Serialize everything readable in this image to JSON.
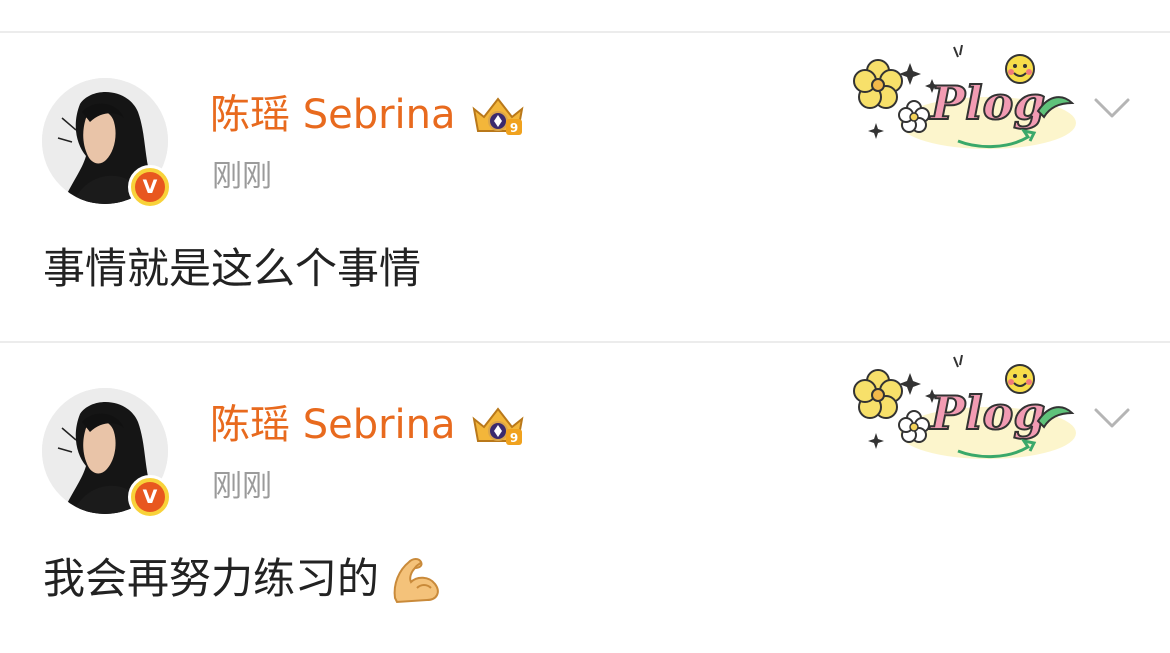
{
  "posts": [
    {
      "username": "陈瑶 Sebrina",
      "timestamp": "刚刚",
      "text": "事情就是这么个事情",
      "sticker_text": "Plog",
      "verified_letter": "V",
      "vip_level": "9",
      "has_emoji": false
    },
    {
      "username": "陈瑶 Sebrina",
      "timestamp": "刚刚",
      "text": "我会再努力练习的",
      "sticker_text": "Plog",
      "verified_letter": "V",
      "vip_level": "9",
      "has_emoji": true,
      "emoji": "flexed-biceps-icon"
    }
  ],
  "colors": {
    "username": "#e86a1e",
    "timestamp": "#9b9b9b",
    "post_text": "#222222",
    "verified_badge": "#e8571f",
    "verified_ring": "#f8d23a",
    "divider": "#ececec"
  }
}
